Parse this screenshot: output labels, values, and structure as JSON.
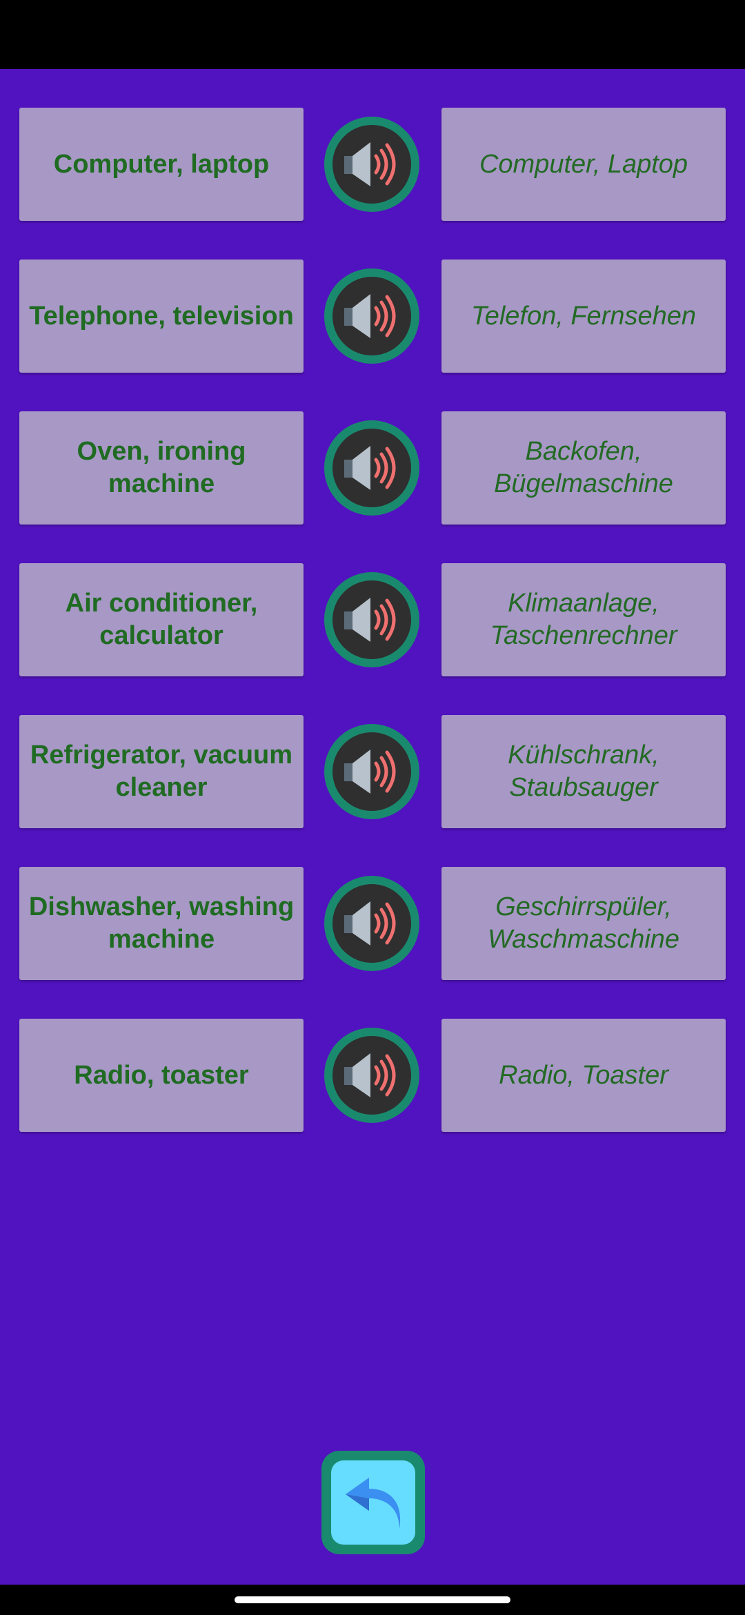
{
  "colors": {
    "background": "#5113bf",
    "card": "#a898c6",
    "text": "#1f6b22",
    "speaker_ring": "#1a8a6e",
    "back_button": "#66dcff"
  },
  "items": [
    {
      "english": "Computer, laptop",
      "german": "Computer, Laptop",
      "icon": "speaker-icon"
    },
    {
      "english": "Telephone, television",
      "german": "Telefon, Fernsehen",
      "icon": "speaker-icon"
    },
    {
      "english": "Oven, ironing machine",
      "german": "Backofen, Bügelmaschine",
      "icon": "speaker-icon"
    },
    {
      "english": "Air conditioner, calculator",
      "german": "Klimaanlage, Taschenrechner",
      "icon": "speaker-icon"
    },
    {
      "english": "Refrigerator, vacuum cleaner",
      "german": "Kühlschrank, Staubsauger",
      "icon": "speaker-icon"
    },
    {
      "english": "Dishwasher, washing machine",
      "german": "Geschirrspüler, Waschmaschine",
      "icon": "speaker-icon"
    },
    {
      "english": "Radio, toaster",
      "german": "Radio, Toaster",
      "icon": "speaker-icon"
    }
  ],
  "back_button": {
    "icon": "back-arrow-icon"
  }
}
